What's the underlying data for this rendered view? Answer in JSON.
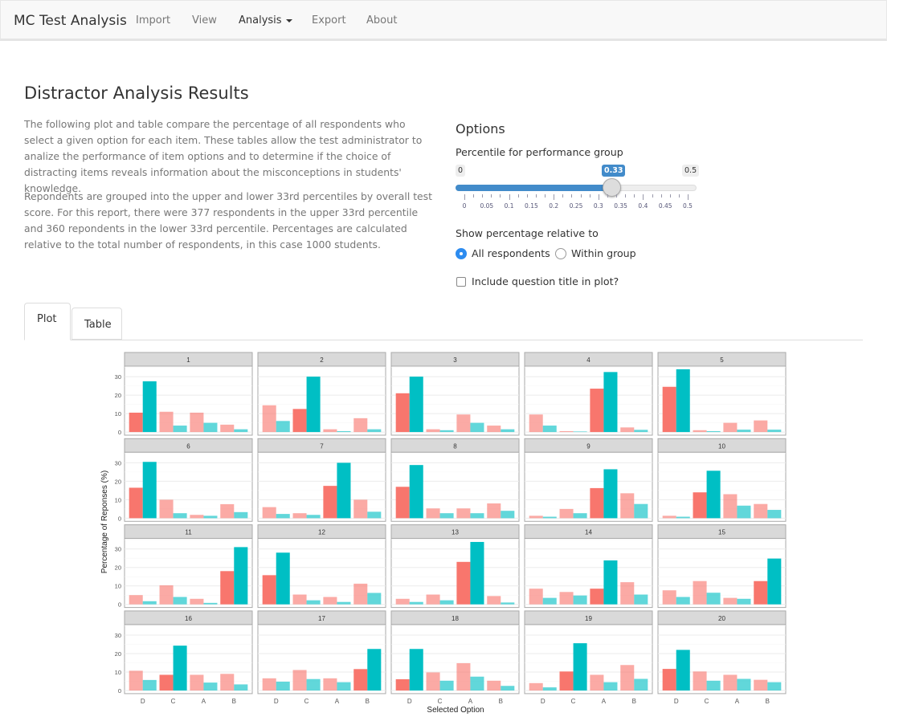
{
  "navbar": {
    "brand": "MC Test Analysis",
    "items": [
      {
        "label": "Import"
      },
      {
        "label": "View"
      },
      {
        "label": "Analysis",
        "active": true,
        "dropdown": true
      },
      {
        "label": "Export"
      },
      {
        "label": "About"
      }
    ]
  },
  "page": {
    "title": "Distractor Analysis Results",
    "paragraphs": [
      "The following plot and table compare the percentage of all respondents who select a given option for each item. These tables allow the test administrator to analize the performance of item options and to determine if the choice of distracting items reveals information about the misconceptions in students' knowledge.",
      "Repondents are grouped into the upper and lower 33rd percentiles by overall test score. For this report, there were 377 respondents in the upper 33rd percentile and 360 repondents in the lower 33rd percentile. Percentages are calculated relative to the total number of respondents, in this case 1000 students."
    ]
  },
  "options": {
    "title": "Options",
    "slider": {
      "label": "Percentile for performance group",
      "min": "0",
      "max": "0.5",
      "value": "0.33",
      "value_num": 0.33,
      "ticks": [
        "0",
        "0.05",
        "0.1",
        "0.15",
        "0.2",
        "0.25",
        "0.3",
        "0.35",
        "0.4",
        "0.45",
        "0.5"
      ],
      "accent": "#428bca"
    },
    "relative": {
      "label": "Show percentage relative to",
      "choices": [
        {
          "label": "All respondents",
          "selected": true
        },
        {
          "label": "Within group",
          "selected": false
        }
      ]
    },
    "include_title": {
      "label": "Include question title in plot?",
      "checked": false
    }
  },
  "tabs": [
    {
      "label": "Plot",
      "active": true
    },
    {
      "label": "Table",
      "active": false
    }
  ],
  "chart_data": {
    "type": "bar",
    "facet": "item",
    "xlabel": "Selected Option",
    "ylabel": "Percentage of Reponses (%)",
    "categories": [
      "D",
      "C",
      "A",
      "B"
    ],
    "yticks": [
      0,
      10,
      20,
      30
    ],
    "ylim": [
      0,
      35
    ],
    "groups": [
      {
        "key": "lower",
        "color": "#F8766D"
      },
      {
        "key": "upper",
        "color": "#00BFC4"
      }
    ],
    "facets": [
      {
        "title": "1",
        "correct": "D",
        "lower": [
          10.5,
          11,
          10.5,
          4
        ],
        "upper": [
          27.5,
          3.5,
          5,
          1.5
        ]
      },
      {
        "title": "2",
        "correct": "C",
        "lower": [
          14.5,
          12.5,
          1.5,
          7.5
        ],
        "upper": [
          6,
          30,
          0.5,
          1.5
        ]
      },
      {
        "title": "3",
        "correct": "D",
        "lower": [
          21,
          1.5,
          9.5,
          3.5
        ],
        "upper": [
          30,
          1,
          5,
          1.5
        ]
      },
      {
        "title": "4",
        "correct": "A",
        "lower": [
          9.5,
          0.5,
          23.5,
          2.5
        ],
        "upper": [
          3.5,
          0.3,
          32.5,
          1.2
        ]
      },
      {
        "title": "5",
        "correct": "D",
        "lower": [
          24.5,
          1,
          5,
          6.3
        ],
        "upper": [
          34,
          0.5,
          1.3,
          1.3
        ]
      },
      {
        "title": "6",
        "correct": "D",
        "lower": [
          16.5,
          10,
          1.8,
          7.6
        ],
        "upper": [
          30.5,
          2.7,
          1.3,
          3.3
        ]
      },
      {
        "title": "7",
        "correct": "A",
        "lower": [
          6,
          2.7,
          17.5,
          10
        ],
        "upper": [
          2.3,
          1.8,
          30,
          3.5
        ]
      },
      {
        "title": "8",
        "correct": "D",
        "lower": [
          17,
          5.3,
          5.3,
          8
        ],
        "upper": [
          28.8,
          2.7,
          2.7,
          4
        ]
      },
      {
        "title": "9",
        "correct": "A",
        "lower": [
          1.3,
          5,
          16.3,
          13.5
        ],
        "upper": [
          0.8,
          2.7,
          26.5,
          7.7
        ]
      },
      {
        "title": "10",
        "correct": "C",
        "lower": [
          1.3,
          14,
          13,
          7.7
        ],
        "upper": [
          0.8,
          25.7,
          6.8,
          4.5
        ]
      },
      {
        "title": "11",
        "correct": "B",
        "lower": [
          5,
          10.3,
          3,
          18
        ],
        "upper": [
          1.7,
          4,
          0.8,
          31
        ]
      },
      {
        "title": "12",
        "correct": "D",
        "lower": [
          15.8,
          5.3,
          4,
          11.2
        ],
        "upper": [
          28,
          2.2,
          1.3,
          6.2
        ]
      },
      {
        "title": "13",
        "correct": "A",
        "lower": [
          3,
          5.3,
          23,
          4.5
        ],
        "upper": [
          1.3,
          2.2,
          33.8,
          1
        ]
      },
      {
        "title": "14",
        "correct": "A",
        "lower": [
          8.5,
          6.7,
          8.5,
          12
        ],
        "upper": [
          3.5,
          4.8,
          23.8,
          5.3
        ]
      },
      {
        "title": "15",
        "correct": "B",
        "lower": [
          7.6,
          12.6,
          3.5,
          12.6
        ],
        "upper": [
          4,
          6.3,
          3,
          24.8
        ]
      },
      {
        "title": "16",
        "correct": "C",
        "lower": [
          10.7,
          8.5,
          8.5,
          9
        ],
        "upper": [
          5.7,
          24.3,
          4.3,
          3.3
        ]
      },
      {
        "title": "17",
        "correct": "B",
        "lower": [
          6.6,
          11.1,
          6.6,
          11.6
        ],
        "upper": [
          4.8,
          6.2,
          4.5,
          22.5
        ]
      },
      {
        "title": "18",
        "correct": "D",
        "lower": [
          6.1,
          9.8,
          14.8,
          5.3
        ],
        "upper": [
          22.5,
          5.3,
          7.5,
          2.5
        ]
      },
      {
        "title": "19",
        "correct": "C",
        "lower": [
          4,
          10.3,
          8.5,
          13.8
        ],
        "upper": [
          1.7,
          25.6,
          4.5,
          6.3
        ]
      },
      {
        "title": "20",
        "correct": "D",
        "lower": [
          11.7,
          10.3,
          8.5,
          5.8
        ],
        "upper": [
          22,
          5.3,
          6.3,
          4.5
        ]
      }
    ]
  }
}
